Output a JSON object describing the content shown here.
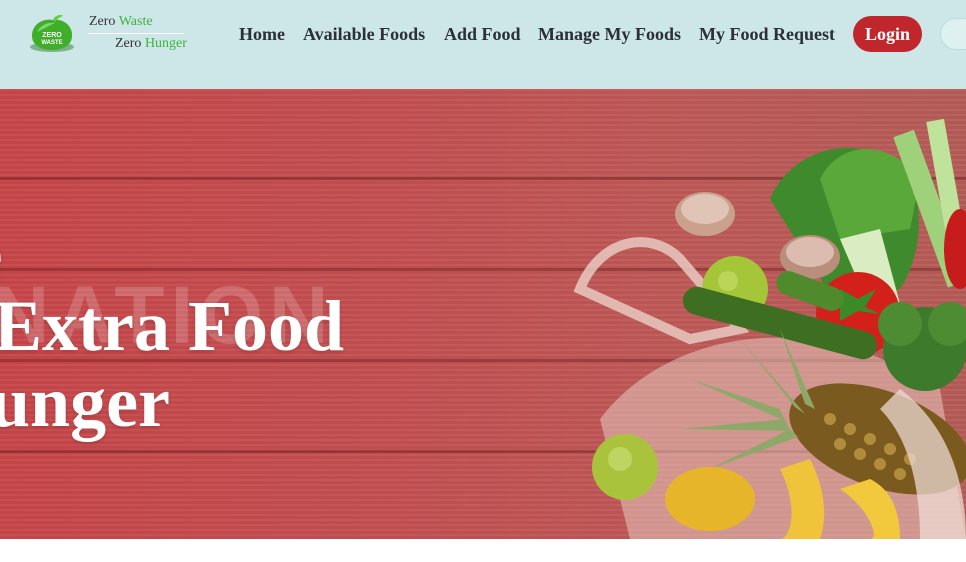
{
  "brand": {
    "line1_prefix": "Zero ",
    "line1_highlight": "Waste",
    "line2_prefix": "Zero ",
    "line2_highlight": "Hunger",
    "logo_text_top": "ZERO",
    "logo_text_bottom": "WASTE",
    "highlight_color": "#3bb53b"
  },
  "nav": {
    "links": [
      {
        "label": "Home"
      },
      {
        "label": "Available Foods"
      },
      {
        "label": "Add Food"
      },
      {
        "label": "Manage My Foods"
      },
      {
        "label": "My Food Request"
      }
    ],
    "login_label": "Login",
    "login_color": "#c0272d",
    "background": "#cde7e8"
  },
  "hero": {
    "line1": "e",
    "line2": "Extra Food",
    "line3": "unger",
    "watermark": "NATION",
    "overlay_color": "#c24b4e"
  }
}
